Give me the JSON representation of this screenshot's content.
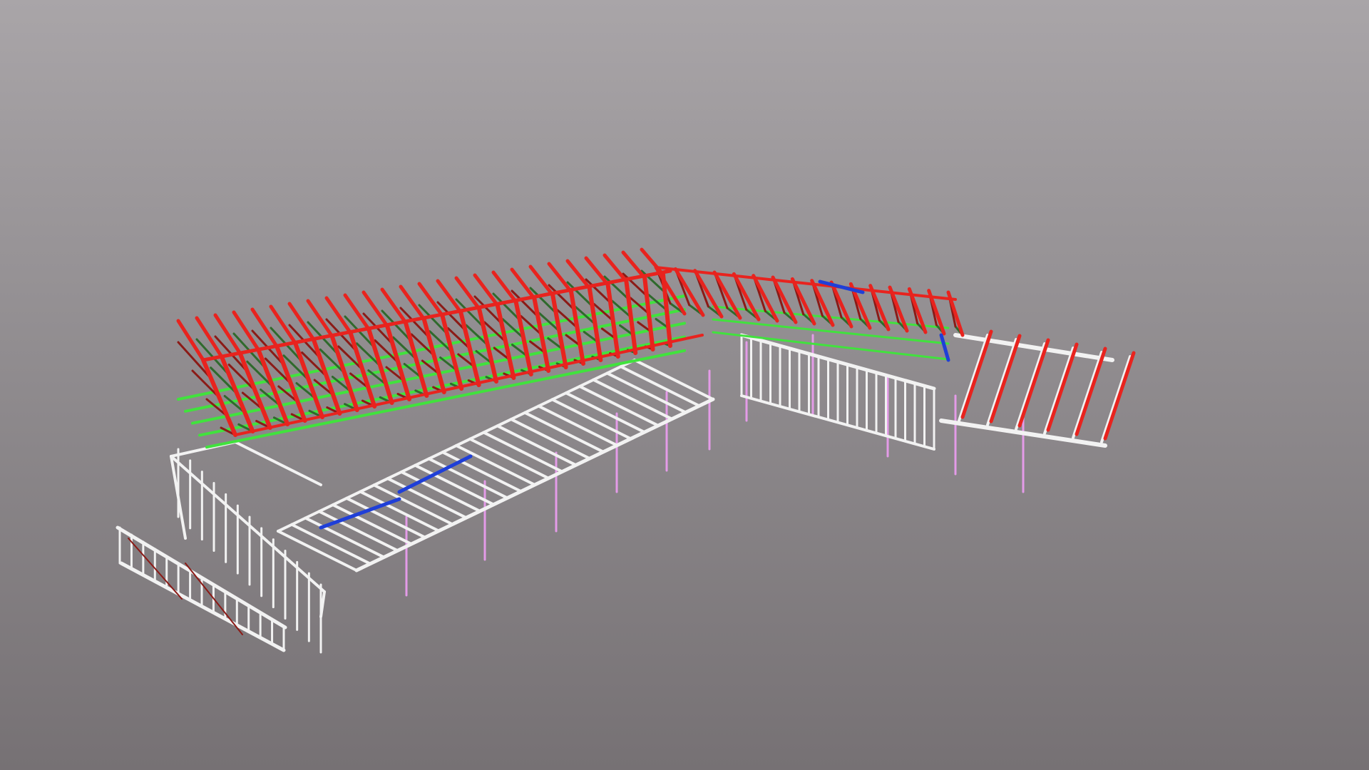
{
  "viewer": {
    "background_top": "#a9a5a8",
    "background_bottom": "#767174"
  },
  "model": {
    "subject": "steel-frame-building-3d-wireframe",
    "member_colors": {
      "truss_chord": "#e8231e",
      "truss_web": "#2f6a2c",
      "truss_web_dark": "#8b1a16",
      "purlin": "#41e23d",
      "blue_brace": "#1f3fd8",
      "wall_frame": "#f2f2f2",
      "column_post": "#e49be8"
    }
  }
}
